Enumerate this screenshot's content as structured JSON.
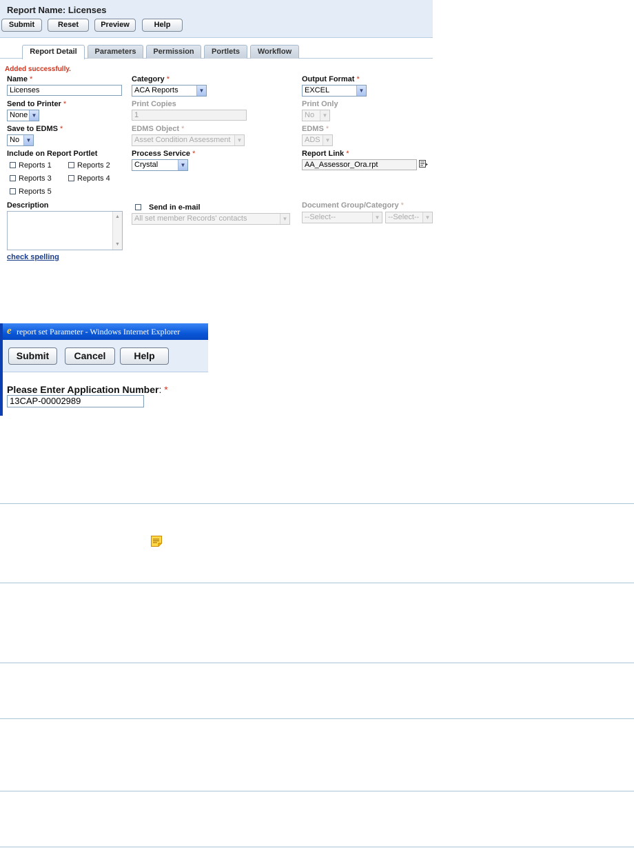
{
  "report": {
    "title": "Report Name: Licenses",
    "buttons": {
      "submit": "Submit",
      "reset": "Reset",
      "preview": "Preview",
      "help": "Help"
    },
    "tabs": [
      "Report Detail",
      "Parameters",
      "Permission",
      "Portlets",
      "Workflow"
    ],
    "active_tab": "Report Detail",
    "message": "Added successfully.",
    "required_mark": "*",
    "fields": {
      "name": {
        "label": "Name",
        "value": "Licenses"
      },
      "category": {
        "label": "Category",
        "value": "ACA Reports"
      },
      "output_format": {
        "label": "Output Format",
        "value": "EXCEL"
      },
      "send_to_printer": {
        "label": "Send to Printer",
        "value": "None"
      },
      "print_copies": {
        "label": "Print Copies",
        "value": "1"
      },
      "print_only": {
        "label": "Print Only",
        "value": "No"
      },
      "save_to_edms": {
        "label": "Save to EDMS",
        "value": "No"
      },
      "edms_object": {
        "label": "EDMS Object",
        "value": "Asset Condition Assessment"
      },
      "edms": {
        "label": "EDMS",
        "value": "ADS"
      },
      "include_portlet": {
        "label": "Include on Report Portlet",
        "options": [
          "Reports 1",
          "Reports 2",
          "Reports 3",
          "Reports 4",
          "Reports 5"
        ]
      },
      "process_service": {
        "label": "Process Service",
        "value": "Crystal"
      },
      "report_link": {
        "label": "Report Link",
        "value": "AA_Assessor_Ora.rpt"
      },
      "description": {
        "label": "Description",
        "value": ""
      },
      "send_email": {
        "label": "Send in e-mail",
        "recipients": "All set member Records' contacts"
      },
      "document_group": {
        "label": "Document Group/Category",
        "group_value": "--Select--",
        "category_value": "--Select--"
      }
    },
    "check_spelling": "check spelling"
  },
  "dialog": {
    "window_title": "report set Parameter - Windows Internet Explorer",
    "buttons": {
      "submit": "Submit",
      "cancel": "Cancel",
      "help": "Help"
    },
    "label": "Please Enter Application Number",
    "label_suffix": ":",
    "required_mark": "*",
    "value": "13CAP-00002989"
  },
  "colors": {
    "header_bg": "#e3ecf7",
    "required": "#d2321a",
    "link": "#1b3d8a",
    "ie_titlebar": "#0a57d8"
  },
  "icons": [
    "report-link-lookup-icon",
    "ie-logo-icon",
    "note-icon"
  ]
}
